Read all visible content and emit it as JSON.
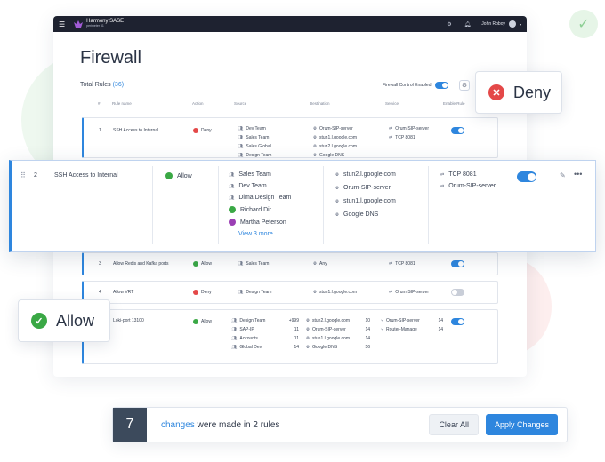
{
  "topbar": {
    "brand_name": "Harmony SASE",
    "brand_sub": "perimeter 81",
    "user_name": "John Roboy"
  },
  "page": {
    "title": "Firewall",
    "total_label": "Total Rules",
    "total_count": "(36)",
    "firewall_control_label": "Firewall Control Enabled"
  },
  "columns": {
    "num": "#",
    "rule_name": "Rule name",
    "action": "Action",
    "source": "Source",
    "destination": "Destination",
    "service": "Service",
    "enable": "Enable Rule"
  },
  "row1": {
    "num": "1",
    "name": "SSH Access to Internal",
    "action": "Deny",
    "sources": [
      "Dev Team",
      "Sales Team",
      "Sales Global",
      "Design Team"
    ],
    "destinations": [
      "Orum-SIP-server",
      "stun1.l.google.com",
      "stun2.l.google.com",
      "Google DNS"
    ],
    "services": [
      "Orum-SIP-server",
      "TCP 8081"
    ],
    "enabled": true
  },
  "row2": {
    "num": "2",
    "name": "SSH Access to Internal",
    "action": "Allow",
    "sources": [
      "Sales Team",
      "Dev Team",
      "Dima Design Team",
      "Richard Dir",
      "Martha Peterson"
    ],
    "view_more": "View 3 more",
    "destinations": [
      "stun2.l.google.com",
      "Orum-SIP-server",
      "stun1.l.google.com",
      "Google DNS"
    ],
    "services": [
      "TCP 8081",
      "Orum-SIP-server"
    ],
    "enabled": true
  },
  "row3": {
    "num": "3",
    "name": "Allow Redis and Kafka ports",
    "action": "Allow",
    "source": "Sales Team",
    "destination": "Any",
    "service": "TCP 8081",
    "enabled": true
  },
  "row4": {
    "num": "4",
    "name": "Allow VRT",
    "action": "Deny",
    "source": "Design Team",
    "destination": "stun1.l.google.com",
    "service": "Orum-SIP-server",
    "enabled": false
  },
  "row5": {
    "name": "Loki-port 13100",
    "action": "Allow",
    "sources": [
      {
        "name": "Design Team",
        "count": "+999"
      },
      {
        "name": "SAP-IP",
        "count": "11"
      },
      {
        "name": "Accounts",
        "count": "11"
      },
      {
        "name": "Global Dev",
        "count": "14"
      }
    ],
    "destinations": [
      {
        "name": "stun2.l.google.com",
        "count": "10"
      },
      {
        "name": "Orum-SIP-server",
        "count": "14"
      },
      {
        "name": "stun1.l.google.com",
        "count": "14"
      },
      {
        "name": "Google DNS",
        "count": "56"
      }
    ],
    "services": [
      {
        "name": "Orum-SIP-server",
        "count": "14"
      },
      {
        "name": "Router-Manage",
        "count": "14"
      }
    ],
    "enabled": true
  },
  "callouts": {
    "deny": "Deny",
    "allow": "Allow"
  },
  "changes": {
    "count": "7",
    "link": "changes",
    "text": " were made in 2 rules",
    "clear": "Clear All",
    "apply": "Apply Changes"
  },
  "colors": {
    "accent": "#2e86de",
    "deny": "#e44848",
    "allow": "#3aa845",
    "topbar": "#1e2230"
  }
}
